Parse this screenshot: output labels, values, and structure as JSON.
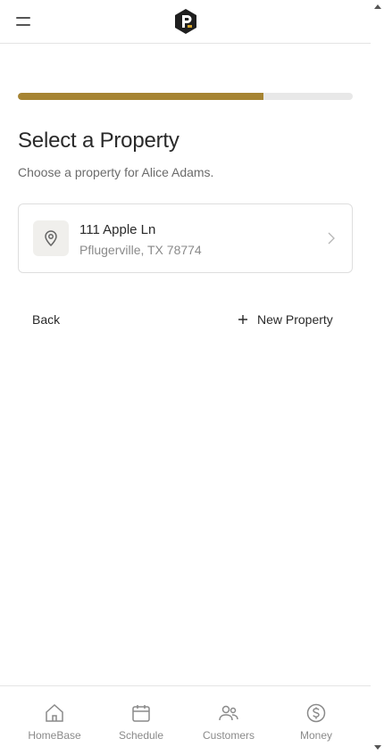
{
  "header": {
    "menu_icon": "hamburger-menu-icon",
    "logo_icon": "brand-logo-icon"
  },
  "progress": {
    "fraction": 0.733,
    "fill_color": "#a68433",
    "track_color": "#e8e8e8"
  },
  "page": {
    "title": "Select a Property",
    "subtitle": "Choose a property for Alice Adams."
  },
  "properties": [
    {
      "address_line1": "111 Apple Ln",
      "address_line2": "Pflugerville, TX 78774",
      "icon": "map-pin-icon"
    }
  ],
  "actions": {
    "back_label": "Back",
    "new_property_label": "New Property"
  },
  "bottom_nav": {
    "items": [
      {
        "label": "HomeBase",
        "icon": "home-icon"
      },
      {
        "label": "Schedule",
        "icon": "calendar-icon"
      },
      {
        "label": "Customers",
        "icon": "users-icon"
      },
      {
        "label": "Money",
        "icon": "dollar-icon"
      }
    ]
  },
  "colors": {
    "accent": "#a68433",
    "text_primary": "#2a2a2a",
    "text_muted": "#8a8a8a"
  }
}
